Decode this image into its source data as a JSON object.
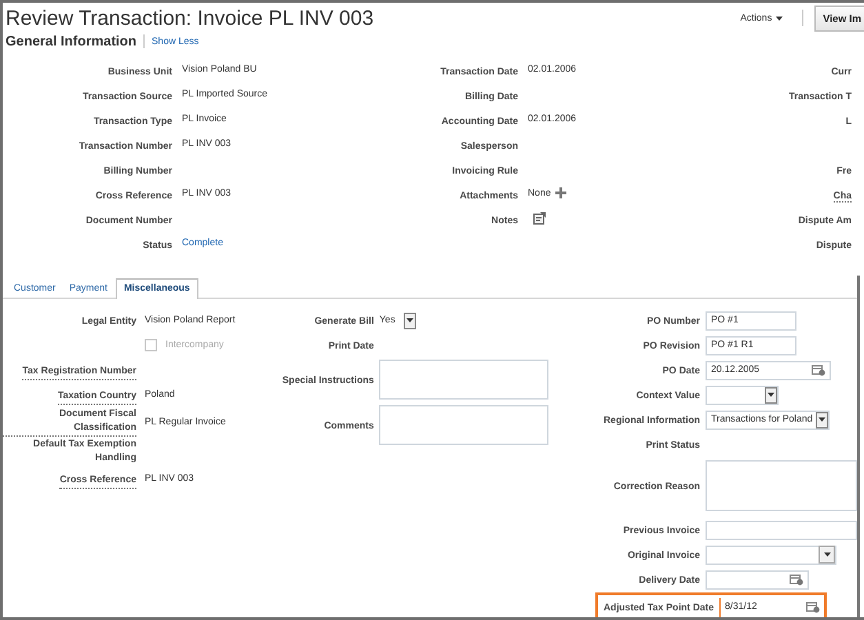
{
  "header": {
    "title": "Review Transaction: Invoice PL INV 003",
    "actions": "Actions",
    "view_button": "View Im"
  },
  "general": {
    "title": "General Information",
    "toggle": "Show Less",
    "rows": [
      {
        "cells": [
          {
            "label": "Business Unit",
            "label_link": false,
            "kind": "text",
            "value": "Vision Poland BU"
          },
          {
            "label": "Transaction Date",
            "label_link": false,
            "kind": "text",
            "value": "02.01.2006"
          },
          {
            "label": "Curr",
            "label_link": false,
            "kind": "text"
          }
        ]
      },
      {
        "cells": [
          {
            "label": "Transaction Source",
            "label_link": false,
            "kind": "text",
            "value": "PL Imported Source"
          },
          {
            "label": "Billing Date",
            "label_link": false,
            "kind": "text"
          },
          {
            "label": "Transaction T",
            "label_link": false,
            "kind": "text"
          }
        ]
      },
      {
        "cells": [
          {
            "label": "Transaction Type",
            "label_link": false,
            "kind": "text",
            "value": "PL Invoice"
          },
          {
            "label": "Accounting Date",
            "label_link": false,
            "kind": "text",
            "value": "02.01.2006"
          },
          {
            "label": "L",
            "label_link": false,
            "kind": "text"
          }
        ]
      },
      {
        "cells": [
          {
            "label": "Transaction Number",
            "label_link": false,
            "kind": "text",
            "value": "PL INV 003"
          },
          {
            "label": "Salesperson",
            "label_link": false,
            "kind": "text"
          },
          null
        ]
      },
      {
        "cells": [
          {
            "label": "Billing Number",
            "label_link": false,
            "kind": "text"
          },
          {
            "label": "Invoicing Rule",
            "label_link": false,
            "kind": "text"
          },
          {
            "label": "Fre",
            "label_link": false,
            "kind": "text"
          }
        ]
      },
      {
        "cells": [
          {
            "label": "Cross Reference",
            "label_link": false,
            "kind": "text",
            "value": "PL INV 003"
          },
          {
            "label": "Attachments",
            "label_link": false,
            "kind": "attachments",
            "value": "None"
          },
          {
            "label": "Cha",
            "label_link": true,
            "kind": "text"
          }
        ]
      },
      {
        "cells": [
          {
            "label": "Document Number",
            "label_link": false,
            "kind": "text"
          },
          {
            "label": "Notes",
            "label_link": false,
            "kind": "notes"
          },
          {
            "label": "Dispute Am",
            "label_link": false,
            "kind": "text"
          }
        ]
      },
      {
        "cells": [
          {
            "label": "Status",
            "label_link": false,
            "kind": "link",
            "value": "Complete"
          },
          null,
          {
            "label": "Dispute",
            "label_link": false,
            "kind": "text"
          }
        ]
      }
    ]
  },
  "tabs": [
    {
      "label": "Customer",
      "selected": false
    },
    {
      "label": "Payment",
      "selected": false
    },
    {
      "label": "Miscellaneous",
      "selected": true
    }
  ],
  "misc": {
    "columns": [
      [
        {
          "label": "Legal Entity",
          "label_link": false,
          "kind": "text",
          "value": "Vision Poland Report"
        },
        {
          "label": "Intercompany",
          "kind": "checkbox",
          "checked": false,
          "disabled": true
        },
        {
          "label": "Tax Registration Number",
          "label_link": true,
          "kind": "text"
        },
        {
          "label": "Taxation Country",
          "label_link": true,
          "kind": "text",
          "value": "Poland"
        },
        {
          "label": "Document Fiscal Classification",
          "label_link": true,
          "kind": "text",
          "value": "PL Regular Invoice"
        },
        {
          "label": "Default Tax Exemption Handling",
          "label_link": false,
          "kind": "text"
        },
        {
          "label": "Cross Reference",
          "label_link": true,
          "kind": "text",
          "value": "PL INV 003"
        }
      ],
      [
        {
          "label": "Generate Bill",
          "label_link": false,
          "kind": "select",
          "value": "Yes"
        },
        {
          "label": "Print Date",
          "label_link": false,
          "kind": "text"
        },
        {
          "label": "Special Instructions",
          "label_link": false,
          "kind": "textarea"
        },
        {
          "label": "Comments",
          "label_link": false,
          "kind": "textarea"
        }
      ],
      [
        {
          "label": "PO Number",
          "label_link": false,
          "kind": "input",
          "value": "PO #1",
          "highlighted": false
        },
        {
          "label": "PO Revision",
          "label_link": false,
          "kind": "input",
          "value": "PO #1 R1",
          "highlighted": false
        },
        {
          "label": "PO Date",
          "label_link": false,
          "kind": "date",
          "value": "20.12.2005",
          "highlighted": false
        },
        {
          "label": "Context Value",
          "label_link": false,
          "kind": "select",
          "highlighted": false
        },
        {
          "label": "Regional Information",
          "label_link": false,
          "kind": "select",
          "value": "Transactions for Poland",
          "highlighted": false
        },
        {
          "label": "Print Status",
          "label_link": false,
          "kind": "text",
          "highlighted": false
        },
        {
          "label": "Correction Reason",
          "label_link": false,
          "kind": "textarea",
          "highlighted": false
        },
        {
          "label": "Previous Invoice",
          "label_link": false,
          "kind": "input",
          "highlighted": false
        },
        {
          "label": "Original Invoice",
          "label_link": false,
          "kind": "select",
          "highlighted": false
        },
        {
          "label": "Delivery Date",
          "label_link": false,
          "kind": "date",
          "highlighted": false
        },
        {
          "label": "Adjusted Tax Point Date",
          "label_link": false,
          "kind": "date",
          "value": "8/31/12",
          "highlighted": true
        }
      ]
    ]
  }
}
